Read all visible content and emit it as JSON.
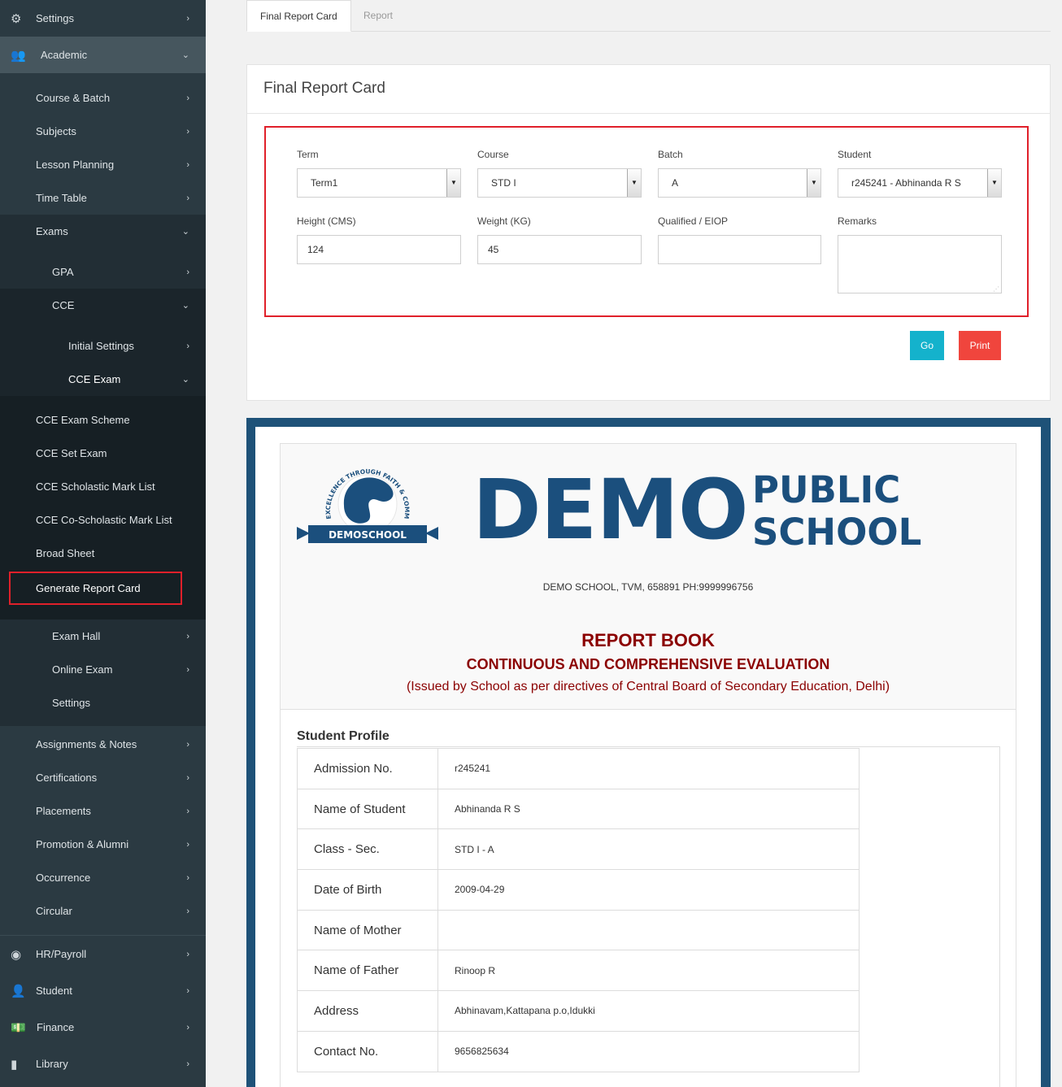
{
  "sidebar": {
    "settings": "Settings",
    "academic": "Academic",
    "course_batch": "Course & Batch",
    "subjects": "Subjects",
    "lesson_planning": "Lesson Planning",
    "time_table": "Time Table",
    "exams": "Exams",
    "gpa": "GPA",
    "cce": "CCE",
    "initial_settings": "Initial Settings",
    "cce_exam": "CCE Exam",
    "cce_exam_scheme": "CCE Exam Scheme",
    "cce_set_exam": "CCE Set Exam",
    "cce_scholastic": "CCE Scholastic Mark List",
    "cce_co_scholastic": "CCE Co-Scholastic Mark List",
    "broad_sheet": "Broad Sheet",
    "generate_report_card": "Generate Report Card",
    "exam_hall": "Exam Hall",
    "online_exam": "Online Exam",
    "exam_settings": "Settings",
    "assignments": "Assignments & Notes",
    "certifications": "Certifications",
    "placements": "Placements",
    "promotion": "Promotion & Alumni",
    "occurrence": "Occurrence",
    "circular": "Circular",
    "hr_payroll": "HR/Payroll",
    "student": "Student",
    "finance": "Finance",
    "library": "Library"
  },
  "tabs": {
    "final_report_card": "Final Report Card",
    "report": "Report"
  },
  "panel": {
    "title": "Final Report Card",
    "term_label": "Term",
    "term_value": "Term1",
    "course_label": "Course",
    "course_value": "STD I",
    "batch_label": "Batch",
    "batch_value": "A",
    "student_label": "Student",
    "student_value": "r245241 - Abhinanda R S",
    "height_label": "Height (CMS)",
    "height_value": "124",
    "weight_label": "Weight (KG)",
    "weight_value": "45",
    "qualified_label": "Qualified / EIOP",
    "qualified_value": "",
    "remarks_label": "Remarks",
    "go": "Go",
    "print": "Print"
  },
  "report": {
    "logo_arc": "EXCELLENCE THROUGH FAITH & COMMITMENT",
    "logo_ribbon": "DEMOSCHOOL",
    "school_big": "DEMO",
    "school_public": "PUBLIC",
    "school_school": "SCHOOL",
    "address": "DEMO SCHOOL, TVM, 658891 PH:9999996756",
    "report_book": "REPORT BOOK",
    "cce": "CONTINUOUS AND COMPREHENSIVE EVALUATION",
    "issued": "(Issued by School as per directives of Central Board of Secondary Education, Delhi)",
    "profile_title": "Student Profile",
    "rows": [
      {
        "k": "Admission No.",
        "v": "r245241"
      },
      {
        "k": "Name of Student",
        "v": "Abhinanda R S"
      },
      {
        "k": "Class - Sec.",
        "v": "STD I - A"
      },
      {
        "k": "Date of Birth",
        "v": "2009-04-29"
      },
      {
        "k": "Name of Mother",
        "v": ""
      },
      {
        "k": "Name of Father",
        "v": "Rinoop R"
      },
      {
        "k": "Address",
        "v": "Abhinavam,Kattapana p.o,Idukki"
      },
      {
        "k": "Contact No.",
        "v": "9656825634"
      }
    ]
  },
  "colors": {
    "sidebar": "#2b3a42",
    "go": "#14b2cc",
    "print": "#f0453d",
    "brand": "#1b4f7d",
    "maroon": "#8b0000",
    "highlight": "#e0202a"
  }
}
